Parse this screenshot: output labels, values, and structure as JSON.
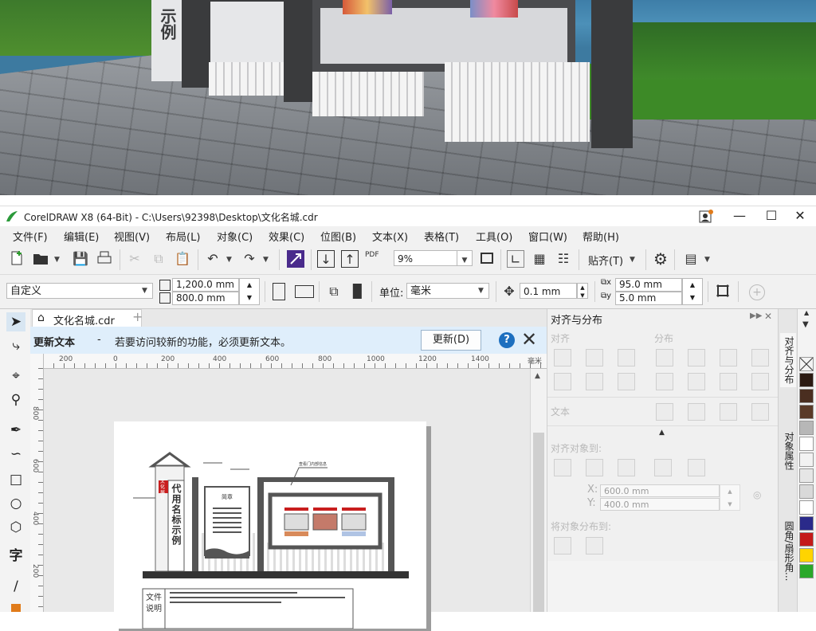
{
  "window": {
    "title": "CorelDRAW X8 (64-Bit) - C:\\Users\\92398\\Desktop\\文化名城.cdr"
  },
  "menus": [
    "文件(F)",
    "编辑(E)",
    "视图(V)",
    "布局(L)",
    "对象(C)",
    "效果(C)",
    "位图(B)",
    "文本(X)",
    "表格(T)",
    "工具(O)",
    "窗口(W)",
    "帮助(H)"
  ],
  "toolbar": {
    "zoom": "9%",
    "snap_label": "贴齐(T)",
    "pdf_label": "PDF"
  },
  "propbar": {
    "preset": "自定义",
    "width": "1,200.0 mm",
    "height": "800.0 mm",
    "unit_label": "单位:",
    "unit": "毫米",
    "nudge": "0.1 mm",
    "dup_x": "95.0 mm",
    "dup_y": "5.0 mm"
  },
  "document": {
    "tab_name": "文化名城.cdr"
  },
  "infobar": {
    "title": "更新文本",
    "dash": "-",
    "message": "若要访问较新的功能，必须更新文本。",
    "update_button": "更新(D)",
    "help": "?"
  },
  "ruler": {
    "h_ticks": [
      "200",
      "0",
      "200",
      "400",
      "600",
      "800",
      "1000",
      "1200",
      "1400"
    ],
    "h_unit": "毫米",
    "v_ticks": [
      "800",
      "600",
      "400",
      "200"
    ]
  },
  "drawing": {
    "badge": "文化展位",
    "sign_text": "代用名标示例",
    "board_title": "简章",
    "pointer_label": "查看门内部信息",
    "note_label_1": "文件",
    "note_label_2": "说明"
  },
  "docker": {
    "title": "对齐与分布",
    "align_label": "对齐",
    "distribute_label": "分布",
    "text_label": "文本",
    "align_to_label": "对齐对象到:",
    "x_label": "X:",
    "x_value": "600.0 mm",
    "y_label": "Y:",
    "y_value": "400.0 mm",
    "distribute_to_label": "将对象分布到:"
  },
  "side_tabs": [
    "对齐与分布",
    "对象属性",
    "圆角/扇形角..."
  ],
  "palette": [
    "#ffffff",
    "#2b1a12",
    "#4a2e20",
    "#5a3a28",
    "#b7b7b7",
    "#ffffff",
    "#f2f2f2",
    "#e6e6e6",
    "#d9d9d9",
    "#ffffff",
    "#2a2a8a",
    "#c41a1a",
    "#ffd400",
    "#2aa82a"
  ],
  "photo": {
    "sign_text": "示例"
  }
}
